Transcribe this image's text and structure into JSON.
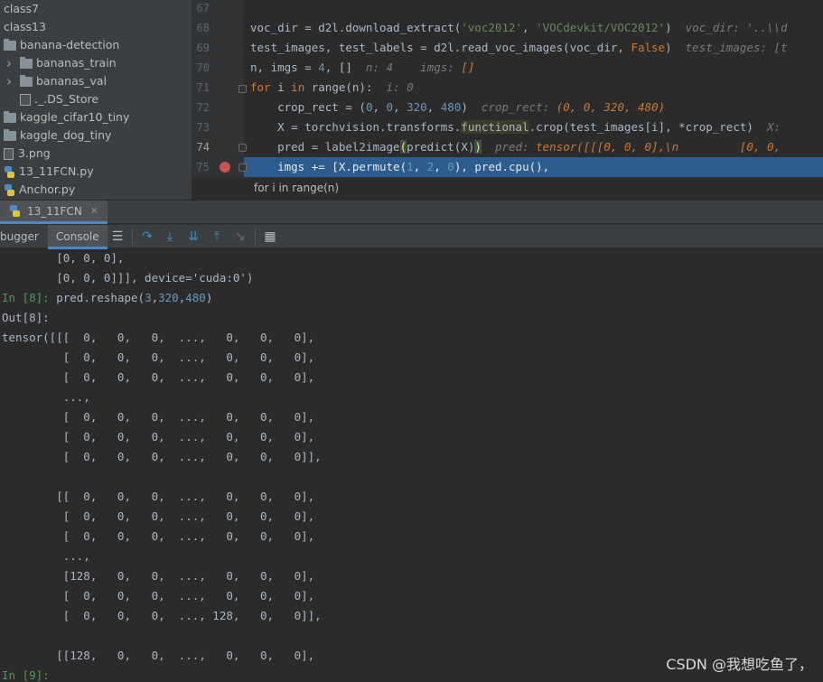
{
  "project_tree": {
    "items": [
      {
        "label": "class7",
        "kind": "folder-plain",
        "indent": 0
      },
      {
        "label": "class13",
        "kind": "folder-plain",
        "indent": 0
      },
      {
        "label": "banana-detection",
        "kind": "folder",
        "indent": 0
      },
      {
        "label": "bananas_train",
        "kind": "folder-collapsed",
        "indent": 1
      },
      {
        "label": "bananas_val",
        "kind": "folder-collapsed",
        "indent": 1
      },
      {
        "label": "._.DS_Store",
        "kind": "file",
        "indent": 2
      },
      {
        "label": "kaggle_cifar10_tiny",
        "kind": "folder",
        "indent": 0
      },
      {
        "label": "kaggle_dog_tiny",
        "kind": "folder",
        "indent": 0
      },
      {
        "label": "3.png",
        "kind": "image",
        "indent": 0
      },
      {
        "label": "13_11FCN.py",
        "kind": "python",
        "indent": 0
      },
      {
        "label": "Anchor.py",
        "kind": "python",
        "indent": 0
      }
    ]
  },
  "editor": {
    "line_numbers": [
      "67",
      "68",
      "69",
      "70",
      "71",
      "72",
      "73",
      "74",
      "75"
    ],
    "current_line": "74",
    "breakpoint_line": "75",
    "lines": [
      [],
      [
        {
          "t": "voc_dir = d2l.download_extract(",
          "c": ""
        },
        {
          "t": "'voc2012'",
          "c": "str"
        },
        {
          "t": ", ",
          "c": ""
        },
        {
          "t": "'VOCdevkit/VOC2012'",
          "c": "str"
        },
        {
          "t": ")  ",
          "c": ""
        },
        {
          "t": "voc_dir: '..\\\\d",
          "c": "hint"
        }
      ],
      [
        {
          "t": "test_images, test_labels = d2l.read_voc_images(voc_dir, ",
          "c": ""
        },
        {
          "t": "False",
          "c": "kw"
        },
        {
          "t": ")  ",
          "c": ""
        },
        {
          "t": "test_images: [t",
          "c": "hint"
        }
      ],
      [
        {
          "t": "n, imgs = ",
          "c": ""
        },
        {
          "t": "4",
          "c": "num"
        },
        {
          "t": ", []  ",
          "c": ""
        },
        {
          "t": "n: 4    imgs: ",
          "c": "hint"
        },
        {
          "t": "[]",
          "c": "hintval"
        }
      ],
      [
        {
          "t": "for ",
          "c": "kw"
        },
        {
          "t": "i ",
          "c": ""
        },
        {
          "t": "in ",
          "c": "kw"
        },
        {
          "t": "range(n):  ",
          "c": ""
        },
        {
          "t": "i: 0",
          "c": "hint"
        }
      ],
      [
        {
          "t": "    crop_rect = (",
          "c": ""
        },
        {
          "t": "0",
          "c": "num"
        },
        {
          "t": ", ",
          "c": ""
        },
        {
          "t": "0",
          "c": "num"
        },
        {
          "t": ", ",
          "c": ""
        },
        {
          "t": "320",
          "c": "num"
        },
        {
          "t": ", ",
          "c": ""
        },
        {
          "t": "480",
          "c": "num"
        },
        {
          "t": ")  ",
          "c": ""
        },
        {
          "t": "crop_rect: ",
          "c": "hint"
        },
        {
          "t": "(0, 0, 320, 480)",
          "c": "hintval"
        }
      ],
      [
        {
          "t": "    X = torchvision.transforms.",
          "c": ""
        },
        {
          "t": "functional",
          "c": "hl-func"
        },
        {
          "t": ".crop(test_images[i], *crop_rect)  ",
          "c": ""
        },
        {
          "t": "X: ",
          "c": "hint"
        }
      ],
      [
        {
          "t": "    pred = label2image",
          "c": ""
        },
        {
          "t": "(",
          "c": "paren-hl"
        },
        {
          "t": "predict(X)",
          "c": ""
        },
        {
          "t": ")",
          "c": "paren-hl"
        },
        {
          "t": "  ",
          "c": ""
        },
        {
          "t": "pred: ",
          "c": "hint"
        },
        {
          "t": "tensor([[[0, 0, 0],\\n         [0, 0, ",
          "c": "hintval"
        }
      ],
      [
        {
          "t": "    imgs += [X.permute(",
          "c": ""
        },
        {
          "t": "1",
          "c": "num"
        },
        {
          "t": ", ",
          "c": ""
        },
        {
          "t": "2",
          "c": "num"
        },
        {
          "t": ", ",
          "c": ""
        },
        {
          "t": "0",
          "c": "num"
        },
        {
          "t": "), pred.cpu(),",
          "c": ""
        }
      ]
    ],
    "breadcrumb": "for i in range(n)"
  },
  "debug_panel": {
    "session_tab": "13_11FCN",
    "tabs": {
      "debugger": "bugger",
      "console": "Console"
    }
  },
  "console": {
    "lines": [
      [
        {
          "t": "        [0, 0, 0],",
          "c": ""
        }
      ],
      [
        {
          "t": "        [0, 0, 0]]], device='cuda:0')",
          "c": ""
        }
      ],
      [
        {
          "t": "In [8]: ",
          "c": "prompt"
        },
        {
          "t": "pred.reshape(",
          "c": ""
        },
        {
          "t": "3",
          "c": "num"
        },
        {
          "t": ",",
          "c": ""
        },
        {
          "t": "320",
          "c": "num"
        },
        {
          "t": ",",
          "c": ""
        },
        {
          "t": "480",
          "c": "num"
        },
        {
          "t": ")",
          "c": ""
        }
      ],
      [
        {
          "t": "Out[8]:",
          "c": ""
        }
      ],
      [
        {
          "t": "tensor([[[  0,   0,   0,  ...,   0,   0,   0],",
          "c": ""
        }
      ],
      [
        {
          "t": "         [  0,   0,   0,  ...,   0,   0,   0],",
          "c": ""
        }
      ],
      [
        {
          "t": "         [  0,   0,   0,  ...,   0,   0,   0],",
          "c": ""
        }
      ],
      [
        {
          "t": "         ...,",
          "c": ""
        }
      ],
      [
        {
          "t": "         [  0,   0,   0,  ...,   0,   0,   0],",
          "c": ""
        }
      ],
      [
        {
          "t": "         [  0,   0,   0,  ...,   0,   0,   0],",
          "c": ""
        }
      ],
      [
        {
          "t": "         [  0,   0,   0,  ...,   0,   0,   0]],",
          "c": ""
        }
      ],
      [
        {
          "t": "",
          "c": ""
        }
      ],
      [
        {
          "t": "        [[  0,   0,   0,  ...,   0,   0,   0],",
          "c": ""
        }
      ],
      [
        {
          "t": "         [  0,   0,   0,  ...,   0,   0,   0],",
          "c": ""
        }
      ],
      [
        {
          "t": "         [  0,   0,   0,  ...,   0,   0,   0],",
          "c": ""
        }
      ],
      [
        {
          "t": "         ...,",
          "c": ""
        }
      ],
      [
        {
          "t": "         [128,   0,   0,  ...,   0,   0,   0],",
          "c": ""
        }
      ],
      [
        {
          "t": "         [  0,   0,   0,  ...,   0,   0,   0],",
          "c": ""
        }
      ],
      [
        {
          "t": "         [  0,   0,   0,  ..., 128,   0,   0]],",
          "c": ""
        }
      ],
      [
        {
          "t": "",
          "c": ""
        }
      ],
      [
        {
          "t": "        [[128,   0,   0,  ...,   0,   0,   0],",
          "c": ""
        }
      ],
      [
        {
          "t": "In [9]:",
          "c": "prompt"
        }
      ]
    ]
  },
  "watermark": "CSDN @我想吃鱼了，"
}
